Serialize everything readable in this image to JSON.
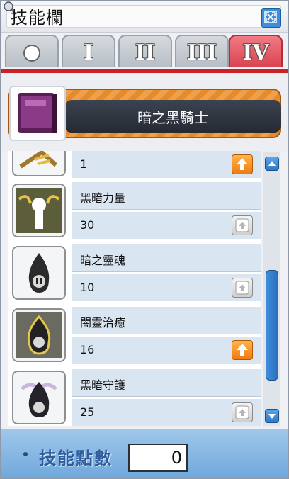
{
  "window": {
    "title": "技能欄"
  },
  "tabs": [
    {
      "label": "○",
      "active": false
    },
    {
      "label": "I",
      "active": false
    },
    {
      "label": "II",
      "active": false
    },
    {
      "label": "III",
      "active": false
    },
    {
      "label": "IV",
      "active": true
    }
  ],
  "job": {
    "name": "暗之黑騎士"
  },
  "skills": [
    {
      "name": "",
      "level": "1",
      "can_level_up": true
    },
    {
      "name": "黑暗力量",
      "level": "30",
      "can_level_up": false
    },
    {
      "name": "暗之靈魂",
      "level": "10",
      "can_level_up": false
    },
    {
      "name": "闇靈治癒",
      "level": "16",
      "can_level_up": true
    },
    {
      "name": "黑暗守護",
      "level": "25",
      "can_level_up": false
    }
  ],
  "footer": {
    "label": "技能點數",
    "value": "0"
  },
  "colors": {
    "accent_red": "#cc2027",
    "levelup_orange": "#f07a10",
    "scroll_blue": "#2f78c7"
  }
}
